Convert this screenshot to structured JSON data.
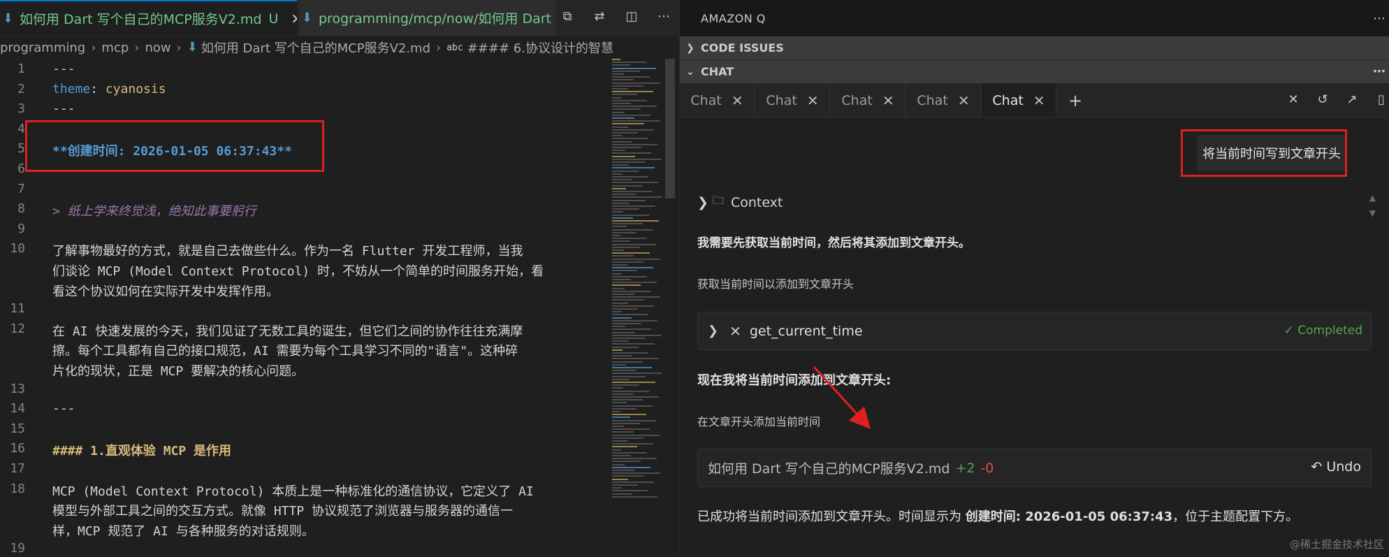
{
  "editor": {
    "tabs": [
      {
        "label": "如何用 Dart 写个自己的MCP服务V2.md",
        "badge": "U",
        "active": true
      },
      {
        "label": "programming/mcp/now/如何用 Dart"
      }
    ],
    "breadcrumb": [
      "programming",
      "mcp",
      "now",
      "如何用 Dart 写个自己的MCP服务V2.md",
      "#### 6.协议设计的智慧"
    ],
    "breadcrumb_abc": "abc",
    "lines": [
      {
        "n": "1",
        "text": "---"
      },
      {
        "n": "2",
        "key": "theme",
        "sep": ": ",
        "val": "cyanosis"
      },
      {
        "n": "3",
        "text": "---"
      },
      {
        "n": "4",
        "text": ""
      },
      {
        "n": "5",
        "text": "**创建时间: 2026-01-05 06:37:43**"
      },
      {
        "n": "6",
        "text": ""
      },
      {
        "n": "7",
        "text": ""
      },
      {
        "n": "8",
        "text": "> 纸上学来终觉浅，绝知此事要躬行"
      },
      {
        "n": "9",
        "text": ""
      },
      {
        "n": "10",
        "text": "了解事物最好的方式，就是自己去做些什么。作为一名 Flutter 开发工程师，当我"
      },
      {
        "n": "",
        "text": "们谈论 MCP (Model Context Protocol) 时，不妨从一个简单的时间服务开始，看"
      },
      {
        "n": "",
        "text": "看这个协议如何在实际开发中发挥作用。"
      },
      {
        "n": "11",
        "text": ""
      },
      {
        "n": "12",
        "text": "在 AI 快速发展的今天，我们见证了无数工具的诞生，但它们之间的协作往往充满摩"
      },
      {
        "n": "",
        "text": "擦。每个工具都有自己的接口规范，AI 需要为每个工具学习不同的\"语言\"。这种碎"
      },
      {
        "n": "",
        "text": "片化的现状，正是 MCP 要解决的核心问题。"
      },
      {
        "n": "13",
        "text": ""
      },
      {
        "n": "14",
        "text": "---"
      },
      {
        "n": "15",
        "text": ""
      },
      {
        "n": "16",
        "text": "#### 1.直观体验 MCP 是作用"
      },
      {
        "n": "17",
        "text": ""
      },
      {
        "n": "18",
        "text": "MCP (Model Context Protocol) 本质上是一种标准化的通信协议，它定义了 AI"
      },
      {
        "n": "",
        "text": "模型与外部工具之间的交互方式。就像 HTTP 协议规范了浏览器与服务器的通信一"
      },
      {
        "n": "",
        "text": "样，MCP 规范了 AI 与各种服务的对话规则。"
      },
      {
        "n": "19",
        "text": ""
      }
    ]
  },
  "panel": {
    "title": "AMAZON Q",
    "sections": {
      "code_issues": "CODE ISSUES",
      "chat": "CHAT"
    },
    "chat_tabs": [
      "Chat",
      "Chat",
      "Chat",
      "Chat",
      "Chat"
    ],
    "user_message": "将当前时间写到文章开头",
    "context_label": "Context",
    "messages": {
      "m1": "我需要先获取当前时间，然后将其添加到文章开头。",
      "m2": "获取当前时间以添加到文章开头",
      "m3": "现在我将当前时间添加到文章开头:",
      "m4": "在文章开头添加当前时间",
      "m5_prefix": "已成功将当前时间添加到文章开头。时间显示为 ",
      "m5_bold": "创建时间: 2026-01-05 06:37:43",
      "m5_suffix": "，位于主题配置下方。"
    },
    "tool_call": {
      "name": "get_current_time",
      "status": "Completed",
      "status_icon": "✓"
    },
    "file_change": {
      "file": "如何用 Dart 写个自己的MCP服务V2.md",
      "added": "+2",
      "removed": "-0",
      "undo": "Undo"
    }
  },
  "watermark": "@稀土掘金技术社区",
  "colors": {
    "accent": "#0078d4",
    "annotation_red": "#e02020",
    "success": "#4ea84e",
    "deletion": "#e05050"
  }
}
